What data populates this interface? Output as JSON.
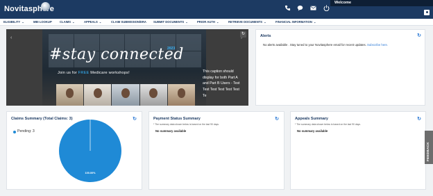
{
  "header": {
    "logo_text": "Novitasphere",
    "welcome_text": "Welcome",
    "icons": [
      "phone-icon",
      "chat-icon",
      "mail-icon",
      "power-icon",
      "user-icon"
    ]
  },
  "nav": {
    "items": [
      {
        "label": "ELIGIBILITY",
        "has_dropdown": true
      },
      {
        "label": "MBI LOOKUP",
        "has_dropdown": false
      },
      {
        "label": "CLAIMS",
        "has_dropdown": true
      },
      {
        "label": "APPEALS",
        "has_dropdown": true
      },
      {
        "label": "CLAIM SUBMISSION/ERA",
        "has_dropdown": false
      },
      {
        "label": "SUBMIT DOCUMENTS",
        "has_dropdown": true
      },
      {
        "label": "PRIOR AUTH",
        "has_dropdown": true
      },
      {
        "label": "RETRIEVE DOCUMENTS",
        "has_dropdown": true
      },
      {
        "label": "FINANCIAL INFORMATION",
        "has_dropdown": true
      }
    ]
  },
  "carousel": {
    "headline": "#stay connected",
    "year": "2023",
    "subline_prefix": "Join us for ",
    "subline_free": "FREE",
    "subline_suffix": " Medicare workshops!",
    "caption": "This caption should display for both Part A and Part B Users - Test Test Test Test Test Test Te"
  },
  "alerts": {
    "title": "Alerts",
    "message": "No alerts available . Stay tuned to your Novitasphere email for recent updates.",
    "link_text": "Subscribe here."
  },
  "claims_summary": {
    "title": "Claims Summary (Total Claims: 3)",
    "legend": [
      {
        "label": "Pending: 3",
        "color": "#1f8ad6"
      }
    ],
    "slice_label": "100.00%"
  },
  "payment_status": {
    "title": "Payment Status Summary",
    "subtitle": "* The summary data shown below is based on the last 90 days.",
    "message": "No summary available"
  },
  "appeals_summary": {
    "title": "Appeals Summary",
    "subtitle": "* The summary data shown below is based on the last 90 days.",
    "message": "No summary available"
  },
  "feedback": {
    "label": "FEEDBACK"
  },
  "chart_data": {
    "type": "pie",
    "categories": [
      "Pending"
    ],
    "values": [
      3
    ],
    "title": "Claims Summary (Total Claims: 3)",
    "data_labels": [
      "100.00%"
    ],
    "legend_placement": "top-left",
    "colors": [
      "#1f8ad6"
    ]
  },
  "colors": {
    "brand_navy": "#1c3a62",
    "accent_blue": "#2c7ad6",
    "pie_blue": "#1f8ad6"
  }
}
